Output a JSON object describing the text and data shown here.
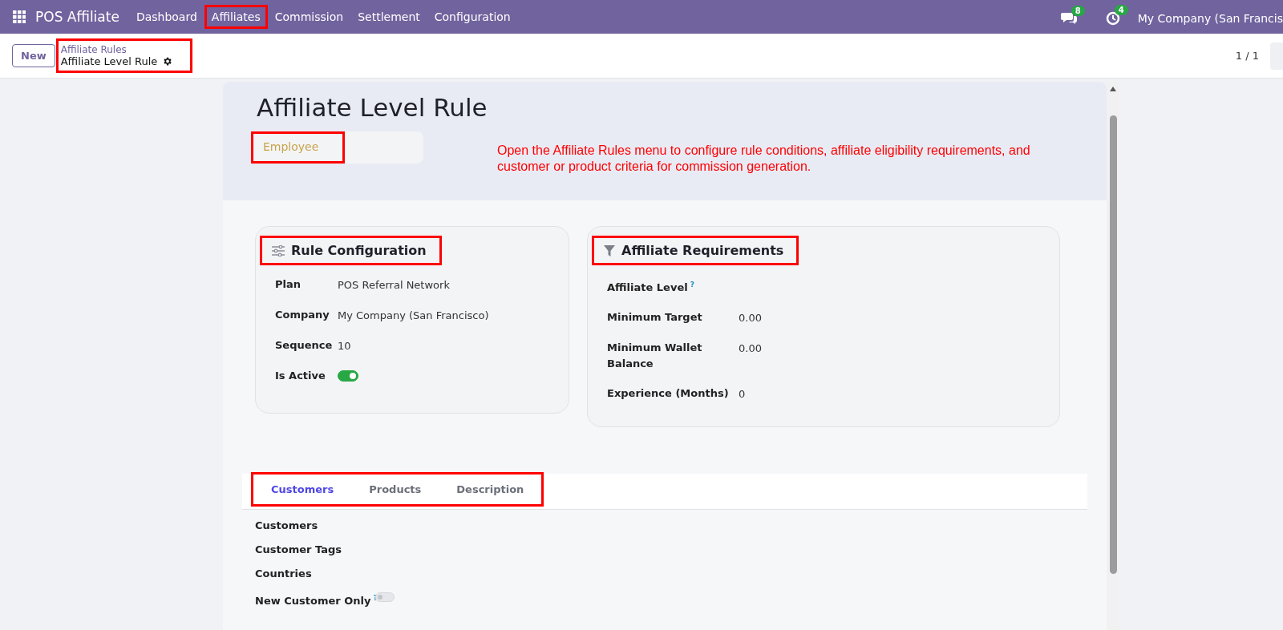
{
  "navbar": {
    "app_name": "POS Affiliate",
    "menu": [
      {
        "label": "Dashboard",
        "highlighted": false
      },
      {
        "label": "Affiliates",
        "highlighted": true
      },
      {
        "label": "Commission",
        "highlighted": false
      },
      {
        "label": "Settlement",
        "highlighted": false
      },
      {
        "label": "Configuration",
        "highlighted": false
      }
    ],
    "messages_count": "8",
    "activities_count": "4",
    "company": "My Company (San Francis"
  },
  "control_panel": {
    "new_button": "New",
    "breadcrumb": {
      "parent": "Affiliate Rules",
      "current": "Affiliate Level Rule",
      "highlighted": true
    },
    "pager": "1 / 1"
  },
  "form": {
    "title": "Affiliate Level Rule",
    "status_badge": {
      "label": "Employee",
      "highlighted": true
    },
    "annotation": "Open the Affiliate Rules menu to configure rule conditions, affiliate eligibility requirements, and customer or product criteria for commission generation.",
    "cards": [
      {
        "title": "Rule Configuration",
        "highlighted": true,
        "fields": [
          {
            "label": "Plan",
            "kind": "text",
            "value": "POS Referral Network"
          },
          {
            "label": "Company",
            "kind": "text",
            "value": "My Company (San Francisco)"
          },
          {
            "label": "Sequence",
            "kind": "text",
            "value": "10"
          },
          {
            "label": "Is Active",
            "kind": "toggle",
            "on": true
          }
        ]
      },
      {
        "title": "Affiliate Requirements",
        "highlighted": true,
        "fields": [
          {
            "label": "Affiliate Level",
            "kind": "empty",
            "help": "?"
          },
          {
            "label": "Minimum Target",
            "kind": "text",
            "value": "0.00"
          },
          {
            "label": "Minimum Wallet Balance",
            "kind": "text",
            "value": "0.00"
          },
          {
            "label": "Experience (Months)",
            "kind": "text",
            "value": "0"
          }
        ]
      }
    ],
    "tabs": {
      "highlighted": true,
      "items": [
        {
          "label": "Customers",
          "selected": true
        },
        {
          "label": "Products",
          "selected": false
        },
        {
          "label": "Description",
          "selected": false
        }
      ]
    },
    "tab_fields": [
      {
        "label": "Customers",
        "kind": "empty"
      },
      {
        "label": "Customer Tags",
        "kind": "empty"
      },
      {
        "label": "Countries",
        "kind": "empty"
      },
      {
        "label": "New Customer Only",
        "kind": "toggle",
        "on": false,
        "help": "?"
      }
    ]
  }
}
